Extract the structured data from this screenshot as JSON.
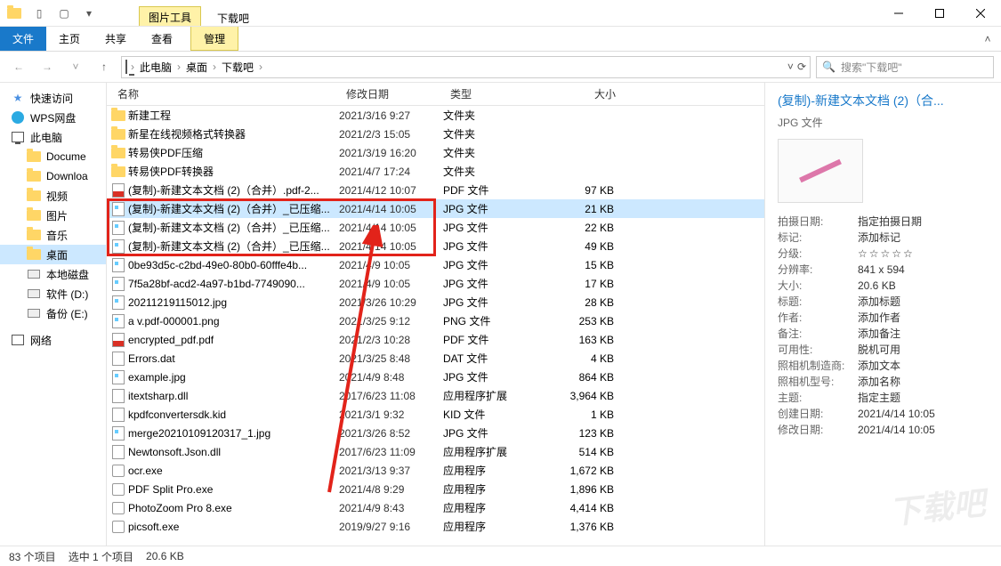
{
  "window": {
    "context_tab": "图片工具",
    "title": "下载吧",
    "ribbon": {
      "file": "文件",
      "home": "主页",
      "share": "共享",
      "view": "查看",
      "manage": "管理"
    }
  },
  "address": {
    "crumbs": [
      "此电脑",
      "桌面",
      "下载吧"
    ],
    "search_placeholder": "搜索\"下载吧\""
  },
  "nav": [
    {
      "label": "快速访问",
      "icon": "star",
      "sub": false
    },
    {
      "label": "WPS网盘",
      "icon": "wps",
      "sub": false
    },
    {
      "label": "此电脑",
      "icon": "pc",
      "sub": false
    },
    {
      "label": "Docume",
      "icon": "folder",
      "sub": true
    },
    {
      "label": "Downloa",
      "icon": "folder",
      "sub": true
    },
    {
      "label": "视频",
      "icon": "folder",
      "sub": true
    },
    {
      "label": "图片",
      "icon": "folder",
      "sub": true
    },
    {
      "label": "音乐",
      "icon": "folder",
      "sub": true
    },
    {
      "label": "桌面",
      "icon": "folder",
      "sub": true,
      "selected": true
    },
    {
      "label": "本地磁盘",
      "icon": "disk",
      "sub": true
    },
    {
      "label": "软件 (D:)",
      "icon": "disk",
      "sub": true
    },
    {
      "label": "备份 (E:)",
      "icon": "disk",
      "sub": true
    },
    {
      "label": "网络",
      "icon": "net",
      "sub": false
    }
  ],
  "columns": {
    "name": "名称",
    "date": "修改日期",
    "type": "类型",
    "size": "大小"
  },
  "rows": [
    {
      "icon": "folder",
      "name": "新建工程",
      "date": "2021/3/16 9:27",
      "type": "文件夹",
      "size": ""
    },
    {
      "icon": "folder",
      "name": "新星在线视频格式转换器",
      "date": "2021/2/3 15:05",
      "type": "文件夹",
      "size": ""
    },
    {
      "icon": "folder",
      "name": "转易侠PDF压缩",
      "date": "2021/3/19 16:20",
      "type": "文件夹",
      "size": ""
    },
    {
      "icon": "folder",
      "name": "转易侠PDF转换器",
      "date": "2021/4/7 17:24",
      "type": "文件夹",
      "size": ""
    },
    {
      "icon": "pdf",
      "name": "(复制)-新建文本文档 (2)（合并）.pdf-2...",
      "date": "2021/4/12 10:07",
      "type": "PDF 文件",
      "size": "97 KB"
    },
    {
      "icon": "img",
      "name": "(复制)-新建文本文档 (2)（合并）_已压缩...",
      "date": "2021/4/14 10:05",
      "type": "JPG 文件",
      "size": "21 KB",
      "selected": true
    },
    {
      "icon": "img",
      "name": "(复制)-新建文本文档 (2)（合并）_已压缩...",
      "date": "2021/4/14 10:05",
      "type": "JPG 文件",
      "size": "22 KB"
    },
    {
      "icon": "img",
      "name": "(复制)-新建文本文档 (2)（合并）_已压缩...",
      "date": "2021/4/14 10:05",
      "type": "JPG 文件",
      "size": "49 KB"
    },
    {
      "icon": "img",
      "name": "0be93d5c-c2bd-49e0-80b0-60fffe4b...",
      "date": "2021/4/9 10:05",
      "type": "JPG 文件",
      "size": "15 KB"
    },
    {
      "icon": "img",
      "name": "7f5a28bf-acd2-4a97-b1bd-7749090...",
      "date": "2021/4/9 10:05",
      "type": "JPG 文件",
      "size": "17 KB"
    },
    {
      "icon": "img",
      "name": "20211219115012.jpg",
      "date": "2021/3/26 10:29",
      "type": "JPG 文件",
      "size": "28 KB"
    },
    {
      "icon": "img",
      "name": "a v.pdf-000001.png",
      "date": "2021/3/25 9:12",
      "type": "PNG 文件",
      "size": "253 KB"
    },
    {
      "icon": "pdf",
      "name": "encrypted_pdf.pdf",
      "date": "2021/2/3 10:28",
      "type": "PDF 文件",
      "size": "163 KB"
    },
    {
      "icon": "file",
      "name": "Errors.dat",
      "date": "2021/3/25 8:48",
      "type": "DAT 文件",
      "size": "4 KB"
    },
    {
      "icon": "img",
      "name": "example.jpg",
      "date": "2021/4/9 8:48",
      "type": "JPG 文件",
      "size": "864 KB"
    },
    {
      "icon": "file",
      "name": "itextsharp.dll",
      "date": "2017/6/23 11:08",
      "type": "应用程序扩展",
      "size": "3,964 KB"
    },
    {
      "icon": "file",
      "name": "kpdfconvertersdk.kid",
      "date": "2021/3/1 9:32",
      "type": "KID 文件",
      "size": "1 KB"
    },
    {
      "icon": "img",
      "name": "merge20210109120317_1.jpg",
      "date": "2021/3/26 8:52",
      "type": "JPG 文件",
      "size": "123 KB"
    },
    {
      "icon": "file",
      "name": "Newtonsoft.Json.dll",
      "date": "2017/6/23 11:09",
      "type": "应用程序扩展",
      "size": "514 KB"
    },
    {
      "icon": "exe",
      "name": "ocr.exe",
      "date": "2021/3/13 9:37",
      "type": "应用程序",
      "size": "1,672 KB"
    },
    {
      "icon": "exe",
      "name": "PDF Split Pro.exe",
      "date": "2021/4/8 9:29",
      "type": "应用程序",
      "size": "1,896 KB"
    },
    {
      "icon": "exe",
      "name": "PhotoZoom Pro 8.exe",
      "date": "2021/4/9 8:43",
      "type": "应用程序",
      "size": "4,414 KB"
    },
    {
      "icon": "exe",
      "name": "picsoft.exe",
      "date": "2019/9/27 9:16",
      "type": "应用程序",
      "size": "1,376 KB"
    }
  ],
  "details": {
    "title": "(复制)-新建文本文档 (2)（合...",
    "subtitle": "JPG 文件",
    "props": [
      {
        "lbl": "拍摄日期:",
        "val": "指定拍摄日期"
      },
      {
        "lbl": "标记:",
        "val": "添加标记"
      },
      {
        "lbl": "分级:",
        "val": "☆☆☆☆☆",
        "stars": true
      },
      {
        "lbl": "分辨率:",
        "val": "841 x 594"
      },
      {
        "lbl": "大小:",
        "val": "20.6 KB"
      },
      {
        "lbl": "标题:",
        "val": "添加标题"
      },
      {
        "lbl": "作者:",
        "val": "添加作者"
      },
      {
        "lbl": "备注:",
        "val": "添加备注"
      },
      {
        "lbl": "可用性:",
        "val": "脱机可用"
      },
      {
        "lbl": "照相机制造商:",
        "val": "添加文本"
      },
      {
        "lbl": "照相机型号:",
        "val": "添加名称"
      },
      {
        "lbl": "主题:",
        "val": "指定主题"
      },
      {
        "lbl": "创建日期:",
        "val": "2021/4/14 10:05"
      },
      {
        "lbl": "修改日期:",
        "val": "2021/4/14 10:05"
      }
    ]
  },
  "status": {
    "count": "83 个项目",
    "sel": "选中 1 个项目",
    "size": "20.6 KB"
  },
  "watermark": "下载吧"
}
